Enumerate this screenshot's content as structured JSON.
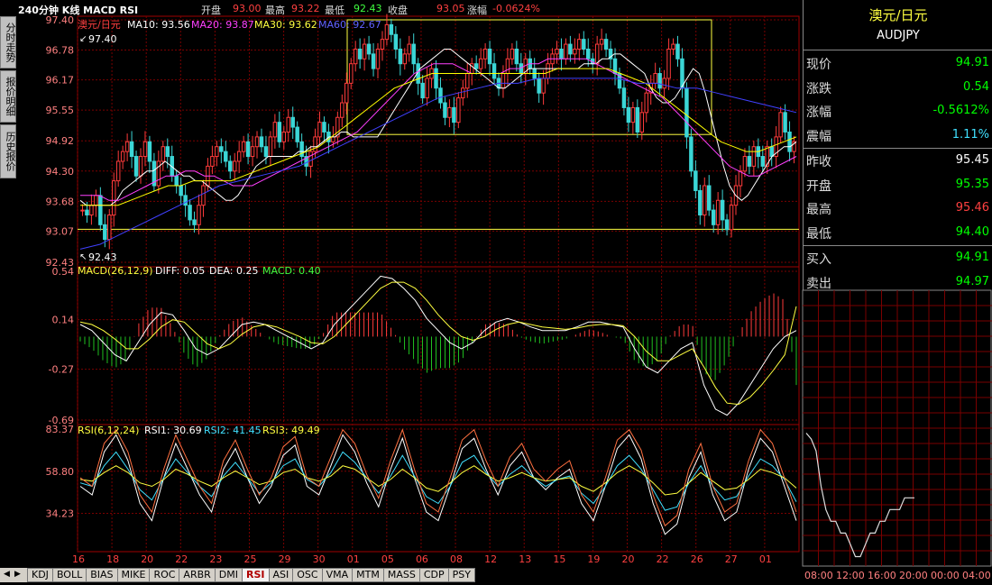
{
  "sidebar": {
    "tabs": [
      {
        "label": "分时走势"
      },
      {
        "label": "报价明细"
      },
      {
        "label": "历史报价"
      }
    ]
  },
  "header": {
    "title": "240分钟 K线 MACD RSI",
    "open_label": "开盘",
    "open_value": "93.00",
    "high_label": "最高",
    "high_value": "93.22",
    "low_label": "最低",
    "low_value": "92.43",
    "close_label": "收盘",
    "close_value": "93.05",
    "change_label": "涨幅",
    "change_value": "-0.0624%"
  },
  "colors": {
    "up": "#ff3b3b",
    "down": "#3bd6d6",
    "ma10": "#ffffff",
    "ma20": "#ff40ff",
    "ma30": "#ffff00",
    "ma60": "#4040ff",
    "grid": "#7a0000",
    "hist_up": "#ff3b3b",
    "hist_down": "#20c020",
    "rsi1": "#ffffff",
    "rsi2": "#40e0ff",
    "rsi3": "#ffff40",
    "box": "#ffff40"
  },
  "quote_panel": {
    "name": "澳元/日元",
    "symbol": "AUDJPY",
    "rows": [
      {
        "label": "现价",
        "value": "94.91",
        "color": "#00ff00"
      },
      {
        "label": "涨跌",
        "value": "0.54",
        "color": "#00ff00"
      },
      {
        "label": "涨幅",
        "value": "-0.5612%",
        "color": "#00ff00"
      },
      {
        "label": "震幅",
        "value": "1.11%",
        "color": "#40e0ff"
      },
      {
        "label": "昨收",
        "value": "95.45",
        "color": "#ffffff"
      },
      {
        "label": "开盘",
        "value": "95.35",
        "color": "#00ff00"
      },
      {
        "label": "最高",
        "value": "95.46",
        "color": "#ff4040"
      },
      {
        "label": "最低",
        "value": "94.40",
        "color": "#00ff00"
      },
      {
        "label": "买入",
        "value": "94.91",
        "color": "#00ff00"
      },
      {
        "label": "卖出",
        "value": "94.97",
        "color": "#00ff00"
      }
    ]
  },
  "chart_data": [
    {
      "type": "candlestick",
      "title": "",
      "legend": {
        "name": "澳元/日元",
        "ma10": "MA10: 93.56",
        "ma20": "MA20: 93.87",
        "ma30": "MA30: 93.62",
        "ma60": "MA60: 92.67"
      },
      "ylim": [
        92.43,
        97.4
      ],
      "y_ticks": [
        "97.40",
        "96.78",
        "96.17",
        "95.55",
        "94.92",
        "94.30",
        "93.68",
        "93.07",
        "92.43"
      ],
      "annotations": {
        "high_label": "97.40",
        "low_label": "92.43"
      },
      "x_ticks": [
        "16",
        "18",
        "20",
        "22",
        "23",
        "25",
        "29",
        "30",
        "01",
        "05",
        "06",
        "08",
        "12",
        "13",
        "15",
        "19",
        "20",
        "22",
        "26",
        "27",
        "01"
      ],
      "series": [
        {
          "name": "price",
          "values": [
            93.5,
            93.4,
            93.6,
            93.8,
            93.2,
            92.9,
            93.4,
            94.1,
            94.5,
            94.7,
            94.9,
            94.6,
            94.2,
            94.6,
            94.9,
            94.5,
            94.0,
            94.5,
            94.8,
            94.6,
            94.2,
            94.0,
            93.8,
            93.6,
            93.3,
            93.2,
            93.6,
            94.0,
            94.4,
            94.6,
            94.8,
            94.7,
            94.5,
            94.3,
            94.5,
            94.7,
            94.9,
            94.6,
            94.8,
            95.0,
            94.8,
            94.6,
            95.0,
            95.3,
            94.9,
            95.1,
            95.4,
            95.2,
            94.9,
            94.6,
            94.4,
            94.7,
            95.0,
            95.3,
            95.1,
            94.9,
            95.0,
            95.4,
            95.7,
            96.1,
            96.5,
            96.8,
            96.6,
            96.9,
            96.7,
            96.4,
            96.8,
            97.0,
            97.3,
            97.1,
            96.8,
            96.5,
            96.7,
            96.9,
            96.5,
            96.1,
            95.8,
            96.2,
            96.4,
            96.0,
            95.7,
            95.4,
            95.6,
            95.3,
            95.8,
            96.0,
            96.3,
            96.5,
            96.4,
            96.6,
            96.8,
            96.5,
            96.2,
            96.0,
            96.3,
            96.6,
            96.8,
            96.5,
            96.3,
            96.6,
            96.4,
            96.2,
            95.9,
            96.2,
            96.5,
            96.7,
            96.8,
            96.6,
            96.9,
            96.7,
            96.8,
            97.0,
            96.8,
            96.6,
            96.5,
            96.9,
            97.0,
            96.8,
            96.6,
            96.3,
            96.0,
            95.6,
            95.3,
            95.6,
            95.1,
            95.5,
            95.9,
            96.1,
            96.3,
            96.0,
            96.2,
            96.8,
            96.9,
            96.6,
            96.0,
            95.0,
            94.3,
            93.9,
            93.4,
            94.0,
            93.5,
            93.2,
            93.7,
            93.3,
            93.1,
            93.6,
            94.0,
            94.3,
            94.6,
            94.4,
            94.8,
            94.6,
            94.4,
            94.8,
            94.6,
            95.0,
            95.5,
            95.1,
            94.7,
            94.9
          ]
        },
        {
          "name": "MA10",
          "values": [
            93.7,
            93.6,
            93.6,
            93.6,
            93.6,
            93.6,
            93.7,
            93.9,
            94.0,
            94.1,
            94.2,
            94.3,
            94.3,
            94.4,
            94.5,
            94.4,
            94.3,
            94.2,
            94.2,
            94.1,
            94.1,
            94.0,
            93.9,
            93.8,
            93.7,
            93.7,
            93.8,
            94.0,
            94.2,
            94.4,
            94.5,
            94.6,
            94.6,
            94.6,
            94.6,
            94.6,
            94.7,
            94.7,
            94.8,
            94.8,
            94.9,
            95.0,
            95.0,
            95.1,
            95.1,
            95.0,
            95.0,
            95.0,
            95.0,
            95.0,
            95.2,
            95.4,
            95.6,
            95.8,
            96.0,
            96.2,
            96.4,
            96.5,
            96.6,
            96.7,
            96.8,
            96.8,
            96.7,
            96.6,
            96.5,
            96.4,
            96.3,
            96.2,
            96.1,
            96.0,
            96.0,
            96.1,
            96.2,
            96.3,
            96.4,
            96.4,
            96.4,
            96.4,
            96.4,
            96.4,
            96.4,
            96.4,
            96.4,
            96.5,
            96.5,
            96.5,
            96.6,
            96.6,
            96.7,
            96.7,
            96.6,
            96.5,
            96.4,
            96.3,
            96.0,
            95.8,
            95.7,
            95.7,
            95.8,
            96.0,
            96.2,
            96.4,
            96.3,
            95.9,
            95.4,
            94.9,
            94.4,
            94.0,
            93.8,
            93.7,
            93.8,
            94.0,
            94.2,
            94.4,
            94.6,
            94.7,
            94.8,
            94.8,
            94.9
          ]
        },
        {
          "name": "MA20",
          "values": [
            93.8,
            93.8,
            93.8,
            93.7,
            93.7,
            93.8,
            93.9,
            94.0,
            94.1,
            94.2,
            94.2,
            94.3,
            94.3,
            94.2,
            94.2,
            94.1,
            94.0,
            94.0,
            94.0,
            94.1,
            94.2,
            94.3,
            94.4,
            94.5,
            94.6,
            94.7,
            94.8,
            94.9,
            95.0,
            95.1,
            95.3,
            95.5,
            95.7,
            95.9,
            96.1,
            96.3,
            96.4,
            96.5,
            96.5,
            96.5,
            96.4,
            96.3,
            96.3,
            96.3,
            96.3,
            96.4,
            96.4,
            96.5,
            96.5,
            96.6,
            96.6,
            96.6,
            96.6,
            96.6,
            96.5,
            96.4,
            96.3,
            96.2,
            96.1,
            96.0,
            95.9,
            95.8,
            95.6,
            95.4,
            95.2,
            95.0,
            94.8,
            94.6,
            94.4,
            94.3,
            94.2,
            94.2,
            94.3,
            94.4,
            94.5,
            94.6
          ]
        },
        {
          "name": "MA30",
          "values": [
            93.6,
            93.6,
            93.6,
            93.6,
            93.7,
            93.8,
            93.9,
            94.0,
            94.0,
            94.1,
            94.1,
            94.1,
            94.1,
            94.2,
            94.3,
            94.4,
            94.5,
            94.6,
            94.7,
            94.8,
            95.0,
            95.2,
            95.4,
            95.6,
            95.8,
            96.0,
            96.1,
            96.2,
            96.3,
            96.3,
            96.3,
            96.3,
            96.3,
            96.3,
            96.3,
            96.3,
            96.3,
            96.3,
            96.4,
            96.4,
            96.4,
            96.4,
            96.4,
            96.3,
            96.2,
            96.1,
            95.9,
            95.7,
            95.5,
            95.3,
            95.1,
            94.9,
            94.8,
            94.7,
            94.7,
            94.8,
            94.9,
            95.0
          ]
        },
        {
          "name": "MA60",
          "values": [
            92.7,
            92.8,
            93.0,
            93.2,
            93.4,
            93.6,
            93.8,
            94.0,
            94.1,
            94.2,
            94.3,
            94.4,
            94.6,
            94.8,
            95.0,
            95.2,
            95.4,
            95.6,
            95.8,
            95.9,
            96.0,
            96.1,
            96.1,
            96.2,
            96.2,
            96.2,
            96.2,
            96.2,
            96.1,
            96.1,
            96.0,
            96.0,
            95.9,
            95.8,
            95.7,
            95.6,
            95.5
          ]
        }
      ]
    },
    {
      "type": "macd",
      "legend": {
        "name": "MACD(26,12,9)",
        "diff": "DIFF: 0.05",
        "dea": "DEA: 0.25",
        "macd": "MACD: 0.40"
      },
      "ylim": [
        -0.69,
        0.54
      ],
      "y_ticks": [
        "0.54",
        "0.14",
        "-0.27",
        "-0.69"
      ],
      "series": [
        {
          "name": "DIFF",
          "values": [
            0.1,
            0.05,
            -0.05,
            -0.15,
            -0.2,
            -0.05,
            0.1,
            0.2,
            0.18,
            0.05,
            -0.1,
            -0.15,
            -0.1,
            0.0,
            0.1,
            0.12,
            0.1,
            0.05,
            0.0,
            -0.05,
            -0.1,
            -0.05,
            0.1,
            0.2,
            0.3,
            0.4,
            0.5,
            0.48,
            0.4,
            0.3,
            0.15,
            0.05,
            -0.05,
            -0.1,
            -0.05,
            0.05,
            0.12,
            0.15,
            0.12,
            0.08,
            0.05,
            0.05,
            0.05,
            0.08,
            0.12,
            0.12,
            0.1,
            0.08,
            -0.1,
            -0.25,
            -0.3,
            -0.2,
            -0.1,
            -0.05,
            -0.4,
            -0.6,
            -0.65,
            -0.55,
            -0.4,
            -0.25,
            -0.1,
            0.0,
            0.05
          ]
        },
        {
          "name": "DEA",
          "values": [
            0.12,
            0.1,
            0.05,
            -0.02,
            -0.1,
            -0.1,
            -0.02,
            0.08,
            0.14,
            0.12,
            0.03,
            -0.06,
            -0.1,
            -0.06,
            0.02,
            0.08,
            0.1,
            0.08,
            0.04,
            0.0,
            -0.05,
            -0.06,
            0.0,
            0.1,
            0.2,
            0.3,
            0.4,
            0.45,
            0.45,
            0.4,
            0.3,
            0.18,
            0.08,
            0.0,
            -0.03,
            0.0,
            0.06,
            0.1,
            0.12,
            0.1,
            0.08,
            0.07,
            0.06,
            0.07,
            0.09,
            0.1,
            0.1,
            0.09,
            0.0,
            -0.12,
            -0.2,
            -0.2,
            -0.15,
            -0.1,
            -0.25,
            -0.42,
            -0.55,
            -0.56,
            -0.5,
            -0.4,
            -0.28,
            -0.15,
            0.25
          ]
        }
      ]
    },
    {
      "type": "rsi",
      "legend": {
        "name": "RSI(6,12,24)",
        "rsi1": "RSI1: 30.69",
        "rsi2": "RSI2: 41.45",
        "rsi3": "RSI3: 49.49"
      },
      "ylim": [
        14,
        83.37
      ],
      "y_ticks": [
        "83.37",
        "58.80",
        "34.23"
      ],
      "series": [
        {
          "name": "RSI1",
          "values": [
            50,
            45,
            70,
            80,
            65,
            40,
            30,
            55,
            75,
            60,
            45,
            35,
            60,
            72,
            55,
            40,
            50,
            68,
            74,
            50,
            45,
            62,
            80,
            70,
            52,
            38,
            60,
            78,
            55,
            35,
            30,
            50,
            72,
            78,
            60,
            45,
            62,
            70,
            55,
            48,
            55,
            60,
            40,
            30,
            50,
            72,
            80,
            66,
            40,
            22,
            28,
            55,
            70,
            45,
            30,
            35,
            60,
            78,
            70,
            50,
            30
          ]
        },
        {
          "name": "RSI2",
          "values": [
            52,
            50,
            62,
            70,
            60,
            48,
            42,
            55,
            66,
            58,
            50,
            44,
            56,
            64,
            55,
            46,
            52,
            62,
            66,
            54,
            50,
            58,
            70,
            64,
            55,
            46,
            56,
            68,
            56,
            44,
            40,
            50,
            64,
            68,
            58,
            50,
            57,
            62,
            55,
            50,
            54,
            56,
            46,
            40,
            50,
            62,
            68,
            60,
            48,
            36,
            38,
            52,
            62,
            50,
            42,
            44,
            56,
            66,
            62,
            54,
            41
          ]
        },
        {
          "name": "RSI3",
          "values": [
            54,
            53,
            58,
            62,
            58,
            52,
            50,
            54,
            60,
            57,
            53,
            50,
            55,
            59,
            55,
            51,
            53,
            58,
            60,
            55,
            53,
            56,
            62,
            60,
            55,
            50,
            54,
            60,
            55,
            49,
            47,
            52,
            58,
            62,
            57,
            53,
            55,
            58,
            55,
            53,
            54,
            55,
            50,
            47,
            52,
            58,
            62,
            58,
            52,
            45,
            46,
            52,
            58,
            53,
            48,
            49,
            54,
            60,
            58,
            55,
            49
          ]
        }
      ]
    },
    {
      "type": "line",
      "x_ticks": [
        "08:00",
        "12:00",
        "16:00",
        "20:00",
        "00:00",
        "04:00"
      ],
      "series": [
        {
          "name": "intraday",
          "values": [
            95.45,
            95.4,
            95.3,
            95.0,
            94.8,
            94.7,
            94.7,
            94.6,
            94.6,
            94.5,
            94.4,
            94.4,
            94.5,
            94.6,
            94.6,
            94.7,
            94.7,
            94.8,
            94.8,
            94.8,
            94.9,
            94.9,
            94.9
          ]
        }
      ]
    }
  ],
  "bottom_tabs": [
    "KDJ",
    "BOLL",
    "BIAS",
    "MIKE",
    "ROC",
    "ARBR",
    "DMI",
    "RSI",
    "ASI",
    "OSC",
    "VMA",
    "MTM",
    "MASS",
    "CDP",
    "PSY"
  ],
  "active_tab": "RSI"
}
